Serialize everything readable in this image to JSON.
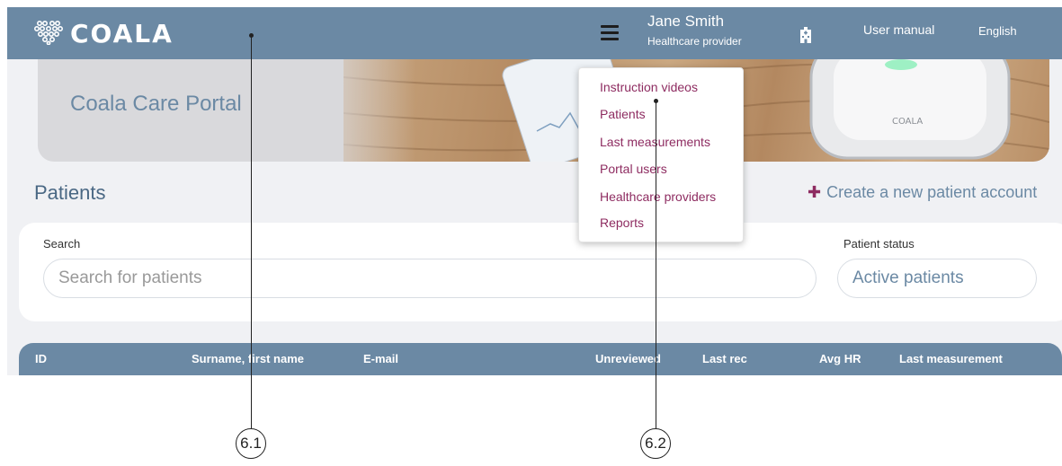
{
  "header": {
    "logo_text": "COALA",
    "user_name": "Jane Smith",
    "user_role": "Healthcare provider",
    "manual_label": "User manual",
    "language_label": "English"
  },
  "banner": {
    "title": "Coala Care Portal"
  },
  "menu": {
    "items": [
      {
        "label": "Instruction videos"
      },
      {
        "label": "Patients"
      },
      {
        "label": "Last measurements"
      },
      {
        "label": "Portal users"
      },
      {
        "label": "Healthcare providers"
      },
      {
        "label": "Reports"
      }
    ]
  },
  "patients": {
    "title": "Patients",
    "create_label": "Create a new patient account",
    "create_icon": "plus-icon"
  },
  "search": {
    "label": "Search",
    "placeholder": "Search for patients",
    "status_label": "Patient status",
    "status_value": "Active patients"
  },
  "table": {
    "columns": [
      "ID",
      "Surname, first name",
      "E-mail",
      "Unreviewed",
      "Last rec",
      "Avg HR",
      "Last measurement"
    ]
  },
  "callouts": [
    {
      "label": "6.1"
    },
    {
      "label": "6.2"
    }
  ],
  "colors": {
    "header_bg": "#6b89a4",
    "menu_text": "#8e2c61",
    "accent_plus": "#8e2c61"
  }
}
